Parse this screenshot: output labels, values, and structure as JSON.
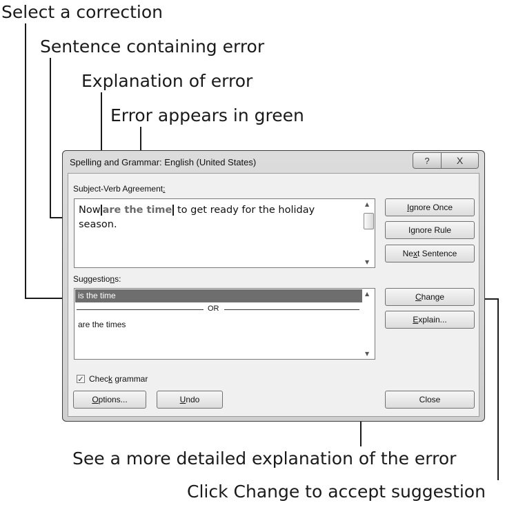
{
  "callouts": {
    "select_correction": "Select a correction",
    "sentence_containing_error": "Sentence containing error",
    "explanation_of_error": "Explanation of error",
    "error_in_green": "Error appears in green",
    "detailed_explanation": "See a more detailed explanation of the error",
    "click_change": "Click Change to accept suggestion"
  },
  "dialog": {
    "title": "Spelling and Grammar: English (United States)",
    "help_glyph": "?",
    "close_glyph": "X",
    "error_type_label": "Subject-Verb Agreement",
    "error_type_suffix": ":",
    "sentence": {
      "before": "Now",
      "error": "are the time",
      "after": "to get ready for the holiday season."
    },
    "buttons_top": {
      "ignore_once_u": "I",
      "ignore_once_rest": "gnore Once",
      "ignore_rule_a": "I",
      "ignore_rule_u": "g",
      "ignore_rule_rest": "nore Rule",
      "next_sentence_a": "Ne",
      "next_sentence_u": "x",
      "next_sentence_rest": "t Sentence"
    },
    "suggestions_label_a": "Suggestio",
    "suggestions_label_u": "n",
    "suggestions_label_rest": "s:",
    "suggestions": {
      "selected": "is the time",
      "separator": "OR",
      "alternate": "are the times"
    },
    "buttons_mid": {
      "change_u": "C",
      "change_rest": "hange",
      "explain_u": "E",
      "explain_rest": "xplain..."
    },
    "check_grammar": {
      "checked": true,
      "label_a": "Chec",
      "label_u": "k",
      "label_rest": " grammar"
    },
    "buttons_bottom": {
      "options_u": "O",
      "options_rest": "ptions...",
      "undo_u": "U",
      "undo_rest": "ndo",
      "close": "Close"
    }
  },
  "colors": {
    "selection": "#6e6e6e",
    "error_text": "#6a6a6a"
  }
}
